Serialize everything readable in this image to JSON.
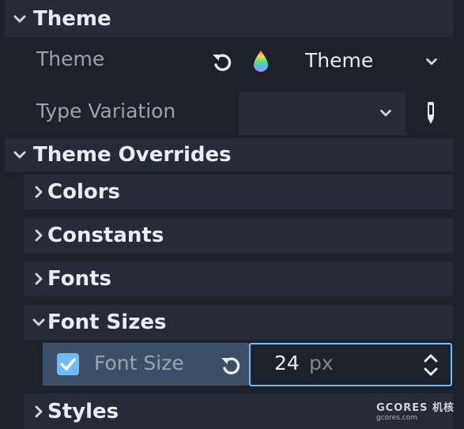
{
  "sections": {
    "theme": {
      "header": "Theme",
      "rows": [
        {
          "label": "Theme",
          "value": "Theme"
        },
        {
          "label": "Type Variation",
          "value": ""
        }
      ]
    },
    "overrides": {
      "header": "Theme Overrides",
      "groups": [
        {
          "label": "Colors"
        },
        {
          "label": "Constants"
        },
        {
          "label": "Fonts"
        },
        {
          "label": "Font Sizes"
        },
        {
          "label": "Styles"
        }
      ],
      "font_size": {
        "label": "Font Size",
        "checked": true,
        "value": "24",
        "unit": "px"
      }
    }
  },
  "watermark": {
    "brand": "GCORES",
    "chinese": "机核",
    "domain": "gcores.com"
  },
  "colors": {
    "accent": "#70bafa",
    "background": "#1c212a",
    "header": "#262c37",
    "selected_row": "#3c4f67"
  }
}
